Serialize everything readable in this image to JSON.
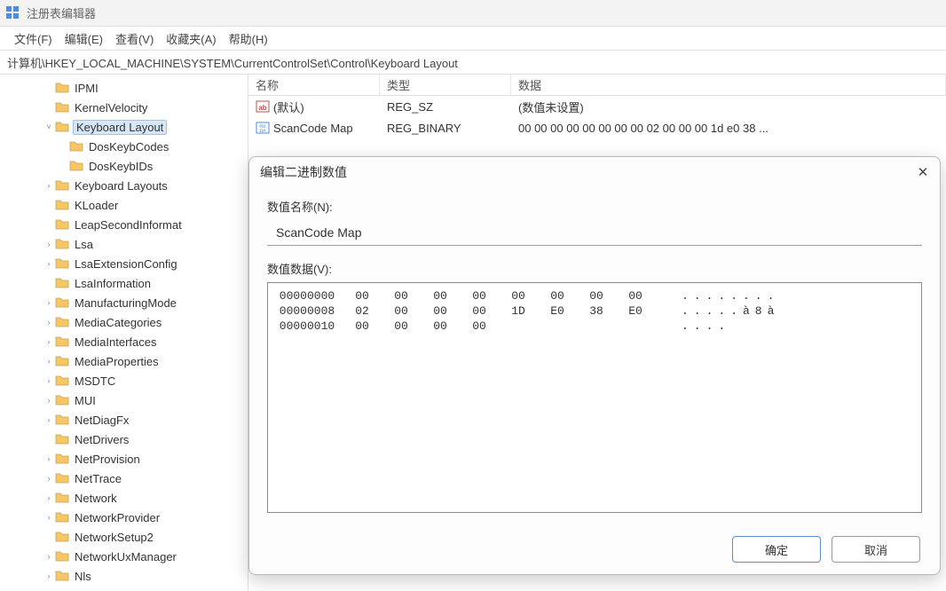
{
  "window": {
    "title": "注册表编辑器"
  },
  "menu": {
    "file": "文件(F)",
    "edit": "编辑(E)",
    "view": "查看(V)",
    "favorites": "收藏夹(A)",
    "help": "帮助(H)"
  },
  "address": "计算机\\HKEY_LOCAL_MACHINE\\SYSTEM\\CurrentControlSet\\Control\\Keyboard Layout",
  "tree": {
    "items": [
      {
        "indent": 3,
        "expander": "",
        "label": "IPMI",
        "selected": false
      },
      {
        "indent": 3,
        "expander": "",
        "label": "KernelVelocity",
        "selected": false
      },
      {
        "indent": 3,
        "expander": "˅",
        "label": "Keyboard Layout",
        "selected": true,
        "open": true
      },
      {
        "indent": 4,
        "expander": "",
        "label": "DosKeybCodes",
        "selected": false
      },
      {
        "indent": 4,
        "expander": "",
        "label": "DosKeybIDs",
        "selected": false
      },
      {
        "indent": 3,
        "expander": "›",
        "label": "Keyboard Layouts",
        "selected": false
      },
      {
        "indent": 3,
        "expander": "",
        "label": "KLoader",
        "selected": false
      },
      {
        "indent": 3,
        "expander": "",
        "label": "LeapSecondInformat",
        "selected": false
      },
      {
        "indent": 3,
        "expander": "›",
        "label": "Lsa",
        "selected": false
      },
      {
        "indent": 3,
        "expander": "›",
        "label": "LsaExtensionConfig",
        "selected": false
      },
      {
        "indent": 3,
        "expander": "",
        "label": "LsaInformation",
        "selected": false
      },
      {
        "indent": 3,
        "expander": "›",
        "label": "ManufacturingMode",
        "selected": false
      },
      {
        "indent": 3,
        "expander": "›",
        "label": "MediaCategories",
        "selected": false
      },
      {
        "indent": 3,
        "expander": "›",
        "label": "MediaInterfaces",
        "selected": false
      },
      {
        "indent": 3,
        "expander": "›",
        "label": "MediaProperties",
        "selected": false
      },
      {
        "indent": 3,
        "expander": "›",
        "label": "MSDTC",
        "selected": false
      },
      {
        "indent": 3,
        "expander": "›",
        "label": "MUI",
        "selected": false
      },
      {
        "indent": 3,
        "expander": "›",
        "label": "NetDiagFx",
        "selected": false
      },
      {
        "indent": 3,
        "expander": "",
        "label": "NetDrivers",
        "selected": false
      },
      {
        "indent": 3,
        "expander": "›",
        "label": "NetProvision",
        "selected": false
      },
      {
        "indent": 3,
        "expander": "›",
        "label": "NetTrace",
        "selected": false
      },
      {
        "indent": 3,
        "expander": "›",
        "label": "Network",
        "selected": false
      },
      {
        "indent": 3,
        "expander": "›",
        "label": "NetworkProvider",
        "selected": false
      },
      {
        "indent": 3,
        "expander": "",
        "label": "NetworkSetup2",
        "selected": false
      },
      {
        "indent": 3,
        "expander": "›",
        "label": "NetworkUxManager",
        "selected": false
      },
      {
        "indent": 3,
        "expander": "›",
        "label": "Nls",
        "selected": false
      }
    ]
  },
  "list": {
    "headers": {
      "name": "名称",
      "type": "类型",
      "data": "数据"
    },
    "rows": [
      {
        "icon": "string",
        "name": "(默认)",
        "type": "REG_SZ",
        "data": "(数值未设置)"
      },
      {
        "icon": "binary",
        "name": "ScanCode Map",
        "type": "REG_BINARY",
        "data": "00 00 00 00 00 00 00 00 02 00 00 00 1d e0 38 ..."
      }
    ]
  },
  "dialog": {
    "title": "编辑二进制数值",
    "name_label": "数值名称(N):",
    "name_value": "ScanCode Map",
    "data_label": "数值数据(V):",
    "hex": [
      {
        "offset": "00000000",
        "bytes": [
          "00",
          "00",
          "00",
          "00",
          "00",
          "00",
          "00",
          "00"
        ],
        "ascii": "........"
      },
      {
        "offset": "00000008",
        "bytes": [
          "02",
          "00",
          "00",
          "00",
          "1D",
          "E0",
          "38",
          "E0"
        ],
        "ascii": ".....à8à"
      },
      {
        "offset": "00000010",
        "bytes": [
          "00",
          "00",
          "00",
          "00"
        ],
        "ascii": "...."
      }
    ],
    "ok": "确定",
    "cancel": "取消"
  }
}
